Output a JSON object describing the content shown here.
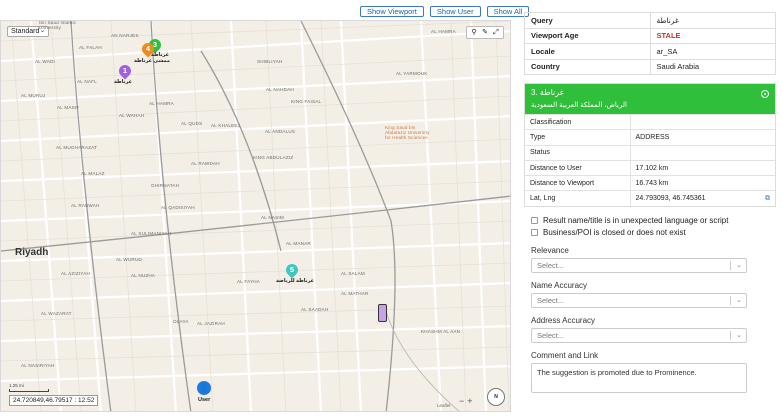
{
  "toolbar": {
    "show_viewport": "Show Viewport",
    "show_user": "Show User",
    "show_all": "Show All"
  },
  "map": {
    "map_type": "Standard",
    "city_label": "Riyadh",
    "coordinates_readout": "24.720849,46.79517 : 12.52",
    "scale_label": "1.25 mi",
    "user_label": "User",
    "poi_label": "King Saud bin Abdulaziz University for Health Sciences",
    "uni_label": "Ibn Saud Islamic University",
    "leaflet_label": "Leaflet",
    "pins": [
      {
        "number": "1",
        "label": "غرناطة",
        "color": "#a060e0"
      },
      {
        "number": "3",
        "label": "غرناطة",
        "color": "#2fbf3a"
      },
      {
        "number": "4",
        "label": "ممشى غرناطة",
        "color": "#f28b1e"
      },
      {
        "number": "5",
        "label": "غرناطة للرياضة",
        "color": "#3fc7c0"
      }
    ],
    "districts": [
      "AL FALAH",
      "AN NARJES",
      "AL WADI",
      "AL NAFL",
      "AL MURUJ",
      "AL WAHAH",
      "AL MASIF",
      "AL MUGHARAZAT",
      "AL MALAZ",
      "AL HAMRA",
      "AL QUDS",
      "AL NAHDAH",
      "KING FAISAL",
      "AL KHALEEJ",
      "AL ANDALUS",
      "GHIRNATAH",
      "AL RAWDAH",
      "AL QADISIYAH",
      "AL NASIM",
      "AL MANAR",
      "AL RABWAH",
      "AL SALAM",
      "AL SAADAH",
      "AL FAYHA",
      "AL JAZIRAH",
      "AL YARMOUK",
      "SHIBLIYAH",
      "AL HAMRA",
      "KHASHM AL AAN",
      "AL NASIRIYAH",
      "AL WAZARAT",
      "OLAYA",
      "AL SULIMANIYAH",
      "AL MATHAR",
      "AL WURUD",
      "AL NUZHA",
      "KING ABDULAZIZ",
      "AL AZIZIYAH"
    ]
  },
  "meta": {
    "rows": [
      {
        "key": "Query",
        "value": "غرناطة"
      },
      {
        "key": "Viewport Age",
        "value": "STALE"
      },
      {
        "key": "Locale",
        "value": "ar_SA"
      },
      {
        "key": "Country",
        "value": "Saudi Arabia"
      }
    ]
  },
  "result": {
    "title": "3. غرناطة",
    "subtitle": "الرياض، المملكة العربية السعودية",
    "details": [
      {
        "key": "Classification",
        "value": ""
      },
      {
        "key": "Type",
        "value": "ADDRESS"
      },
      {
        "key": "Status",
        "value": ""
      },
      {
        "key": "Distance to User",
        "value": "17.102 km"
      },
      {
        "key": "Distance to Viewport",
        "value": "16.743 km"
      },
      {
        "key": "Lat, Lng",
        "value": "24.793093, 46.745361"
      }
    ]
  },
  "checks": [
    "Result name/title is in unexpected language or script",
    "Business/POI is closed or does not exist"
  ],
  "fields": {
    "relevance": {
      "label": "Relevance",
      "placeholder": "Select..."
    },
    "name_accuracy": {
      "label": "Name Accuracy",
      "placeholder": "Select..."
    },
    "address_accuracy": {
      "label": "Address Accuracy",
      "placeholder": "Select..."
    },
    "comment": {
      "label": "Comment and Link",
      "value": "The suggestion is promoted due to Prominence."
    }
  }
}
